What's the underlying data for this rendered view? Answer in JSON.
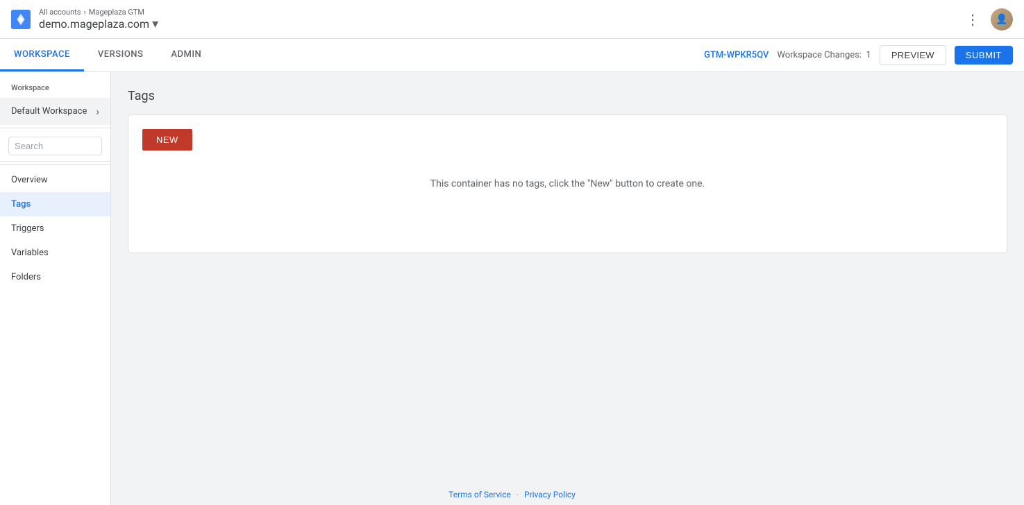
{
  "topbar": {
    "breadcrumb_top_link": "All accounts",
    "breadcrumb_separator": "›",
    "breadcrumb_sub": "Mageplaza GTM",
    "domain": "demo.mageplaza.com",
    "dropdown_arrow": "▾"
  },
  "navbar": {
    "tabs": [
      {
        "label": "WORKSPACE",
        "active": true
      },
      {
        "label": "VERSIONS",
        "active": false
      },
      {
        "label": "ADMIN",
        "active": false
      }
    ],
    "container_id": "GTM-WPKR5QV",
    "workspace_changes_label": "Workspace Changes:",
    "workspace_changes_count": "1",
    "preview_label": "PREVIEW",
    "submit_label": "SUBMIT"
  },
  "sidebar": {
    "section_label": "Workspace",
    "workspace_item_label": "Default Workspace",
    "search_placeholder": "Search",
    "nav_items": [
      {
        "label": "Overview",
        "active": false
      },
      {
        "label": "Tags",
        "active": true
      },
      {
        "label": "Triggers",
        "active": false
      },
      {
        "label": "Variables",
        "active": false
      },
      {
        "label": "Folders",
        "active": false
      }
    ]
  },
  "main": {
    "page_title": "Tags",
    "new_button_label": "NEW",
    "empty_message": "This container has no tags, click the \"New\" button to create one."
  },
  "footer": {
    "terms_label": "Terms of Service",
    "separator": "·",
    "privacy_label": "Privacy Policy"
  }
}
